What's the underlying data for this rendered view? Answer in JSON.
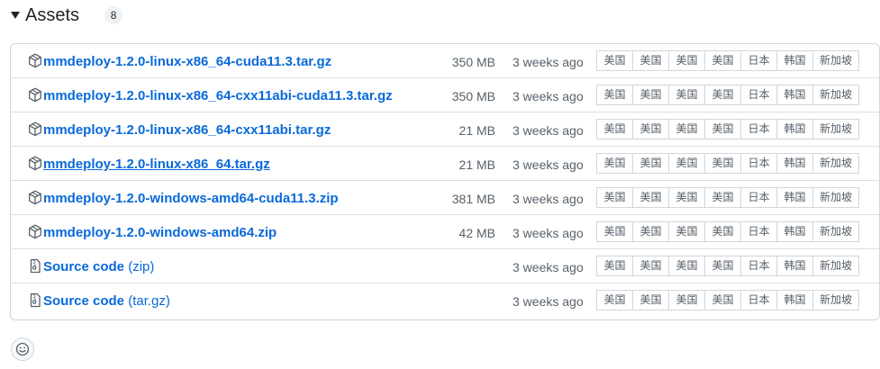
{
  "header": {
    "title": "Assets",
    "count": "8"
  },
  "assets": [
    {
      "name": "mmdeploy-1.2.0-linux-x86_64-cuda11.3.tar.gz",
      "size": "350 MB",
      "time": "3 weeks ago",
      "icon": "package-icon"
    },
    {
      "name": "mmdeploy-1.2.0-linux-x86_64-cxx11abi-cuda11.3.tar.gz",
      "size": "350 MB",
      "time": "3 weeks ago",
      "icon": "package-icon"
    },
    {
      "name": "mmdeploy-1.2.0-linux-x86_64-cxx11abi.tar.gz",
      "size": "21 MB",
      "time": "3 weeks ago",
      "icon": "package-icon"
    },
    {
      "name": "mmdeploy-1.2.0-linux-x86_64.tar.gz",
      "size": "21 MB",
      "time": "3 weeks ago",
      "icon": "package-icon"
    },
    {
      "name": "mmdeploy-1.2.0-windows-amd64-cuda11.3.zip",
      "size": "381 MB",
      "time": "3 weeks ago",
      "icon": "package-icon"
    },
    {
      "name": "mmdeploy-1.2.0-windows-amd64.zip",
      "size": "42 MB",
      "time": "3 weeks ago",
      "icon": "package-icon"
    },
    {
      "name": "Source code",
      "ext": "(zip)",
      "size": "",
      "time": "3 weeks ago",
      "icon": "file-zip-icon"
    },
    {
      "name": "Source code",
      "ext": "(tar.gz)",
      "size": "",
      "time": "3 weeks ago",
      "icon": "file-zip-icon"
    }
  ],
  "mirrors": [
    "美国",
    "美国",
    "美国",
    "美国",
    "日本",
    "韩国",
    "新加坡"
  ],
  "colors": {
    "link": "#0969da",
    "muted": "#57606a",
    "border": "#d0d7de"
  },
  "footer": {
    "icon": "smiley-icon"
  }
}
